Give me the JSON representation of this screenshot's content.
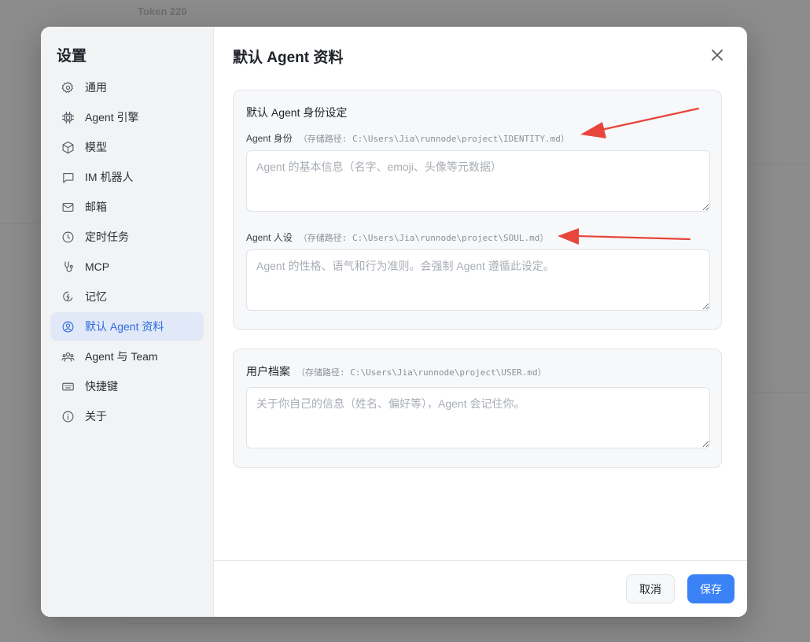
{
  "background": {
    "texts": [
      "Token 220"
    ]
  },
  "settings": {
    "title": "设置",
    "nav": [
      {
        "label": "通用",
        "icon": "gear-icon",
        "active": false
      },
      {
        "label": "Agent 引擎",
        "icon": "chip-icon",
        "active": false
      },
      {
        "label": "模型",
        "icon": "cube-icon",
        "active": false
      },
      {
        "label": "IM 机器人",
        "icon": "chat-bubble-icon",
        "active": false
      },
      {
        "label": "邮箱",
        "icon": "mail-icon",
        "active": false
      },
      {
        "label": "定时任务",
        "icon": "clock-icon",
        "active": false
      },
      {
        "label": "MCP",
        "icon": "plug-icon",
        "active": false
      },
      {
        "label": "记忆",
        "icon": "brain-icon",
        "active": false
      },
      {
        "label": "默认 Agent 资料",
        "icon": "user-circle-icon",
        "active": true
      },
      {
        "label": "Agent 与 Team",
        "icon": "team-icon",
        "active": false
      },
      {
        "label": "快捷键",
        "icon": "keyboard-icon",
        "active": false
      },
      {
        "label": "关于",
        "icon": "info-icon",
        "active": false
      }
    ]
  },
  "main": {
    "title": "默认 Agent 资料",
    "identity_section": {
      "heading": "默认 Agent 身份设定",
      "identity_label": "Agent 身份",
      "identity_path": "（存储路径: C:\\Users\\Jia\\runnode\\project\\IDENTITY.md）",
      "identity_placeholder": "Agent 的基本信息（名字、emoji、头像等元数据）",
      "soul_label": "Agent 人设",
      "soul_path": "（存储路径: C:\\Users\\Jia\\runnode\\project\\SOUL.md）",
      "soul_placeholder": "Agent 的性格、语气和行为准则。会强制 Agent 遵循此设定。"
    },
    "user_section": {
      "label": "用户档案",
      "path": "（存储路径: C:\\Users\\Jia\\runnode\\project\\USER.md）",
      "placeholder": "关于你自己的信息（姓名、偏好等），Agent 会记住你。"
    }
  },
  "footer": {
    "cancel_label": "取消",
    "save_label": "保存"
  },
  "colors": {
    "accent": "#3b82f6",
    "active_nav_bg": "#e1e8f7",
    "annotation_arrow": "#e8453c"
  }
}
